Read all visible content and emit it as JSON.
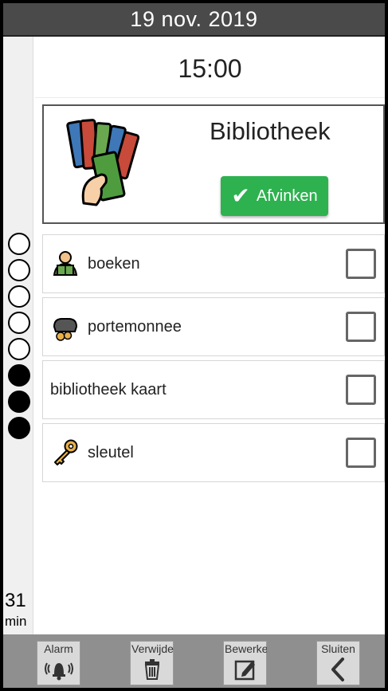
{
  "header": {
    "date": "19 nov. 2019"
  },
  "time": "15:00",
  "timer": {
    "minutes": "31",
    "unit": "min",
    "dots_total": 8,
    "dots_filled": 3
  },
  "activity": {
    "title": "Bibliotheek",
    "picture_icon": "books-icon",
    "check_button": {
      "label": "Afvinken",
      "icon": "checkmark-icon",
      "color": "#2db24f"
    }
  },
  "checklist": [
    {
      "label": "boeken",
      "icon": "reading-person-icon",
      "checked": false
    },
    {
      "label": "portemonnee",
      "icon": "wallet-icon",
      "checked": false
    },
    {
      "label": "bibliotheek kaart",
      "icon": "",
      "checked": false
    },
    {
      "label": "sleutel",
      "icon": "key-icon",
      "checked": false
    }
  ],
  "toolbar": {
    "alarm_label": "Alarm",
    "delete_label": "Verwijderen",
    "edit_label": "Bewerken",
    "close_label": "Sluiten"
  }
}
